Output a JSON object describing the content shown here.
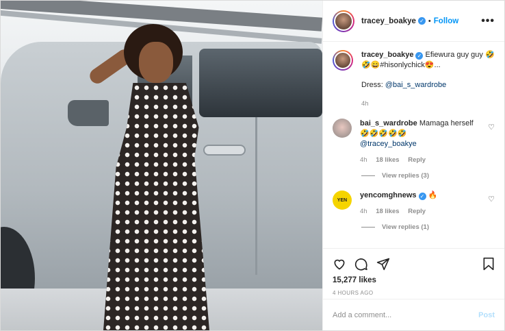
{
  "author": {
    "username": "tracey_boakye",
    "follow_label": "Follow",
    "separator": "•",
    "more_label": "•••"
  },
  "caption": {
    "username": "tracey_boakye",
    "text": "Efiewura guy guy 🤣🤣😄#hisonlychick😍...",
    "dress_prefix": "Dress: ",
    "dress_mention": "@bai_s_wardrobe",
    "age": "4h"
  },
  "comments": [
    {
      "username": "bai_s_wardrobe",
      "text": "Mamaga herself 🤣🤣🤣🤣🤣",
      "mention": "@tracey_boakye",
      "age": "4h",
      "likes": "18 likes",
      "reply_label": "Reply",
      "view_replies": "View replies (3)"
    },
    {
      "username": "yencomghnews",
      "text": "🔥",
      "avatar_text": "YEN",
      "age": "4h",
      "likes": "18 likes",
      "reply_label": "Reply",
      "view_replies": "View replies (1)"
    }
  ],
  "actions": {
    "likes_count": "15,277 likes",
    "timestamp": "4 HOURS AGO"
  },
  "add_comment": {
    "placeholder": "Add a comment...",
    "post_label": "Post"
  },
  "colors": {
    "link": "#0095f6",
    "post_disabled": "#b2dffc",
    "muted": "#8e8e8e",
    "verified": "#3897f0"
  },
  "icons": [
    "verified-badge-icon",
    "more-options-icon",
    "heart-icon",
    "comment-icon",
    "share-icon",
    "bookmark-icon"
  ]
}
